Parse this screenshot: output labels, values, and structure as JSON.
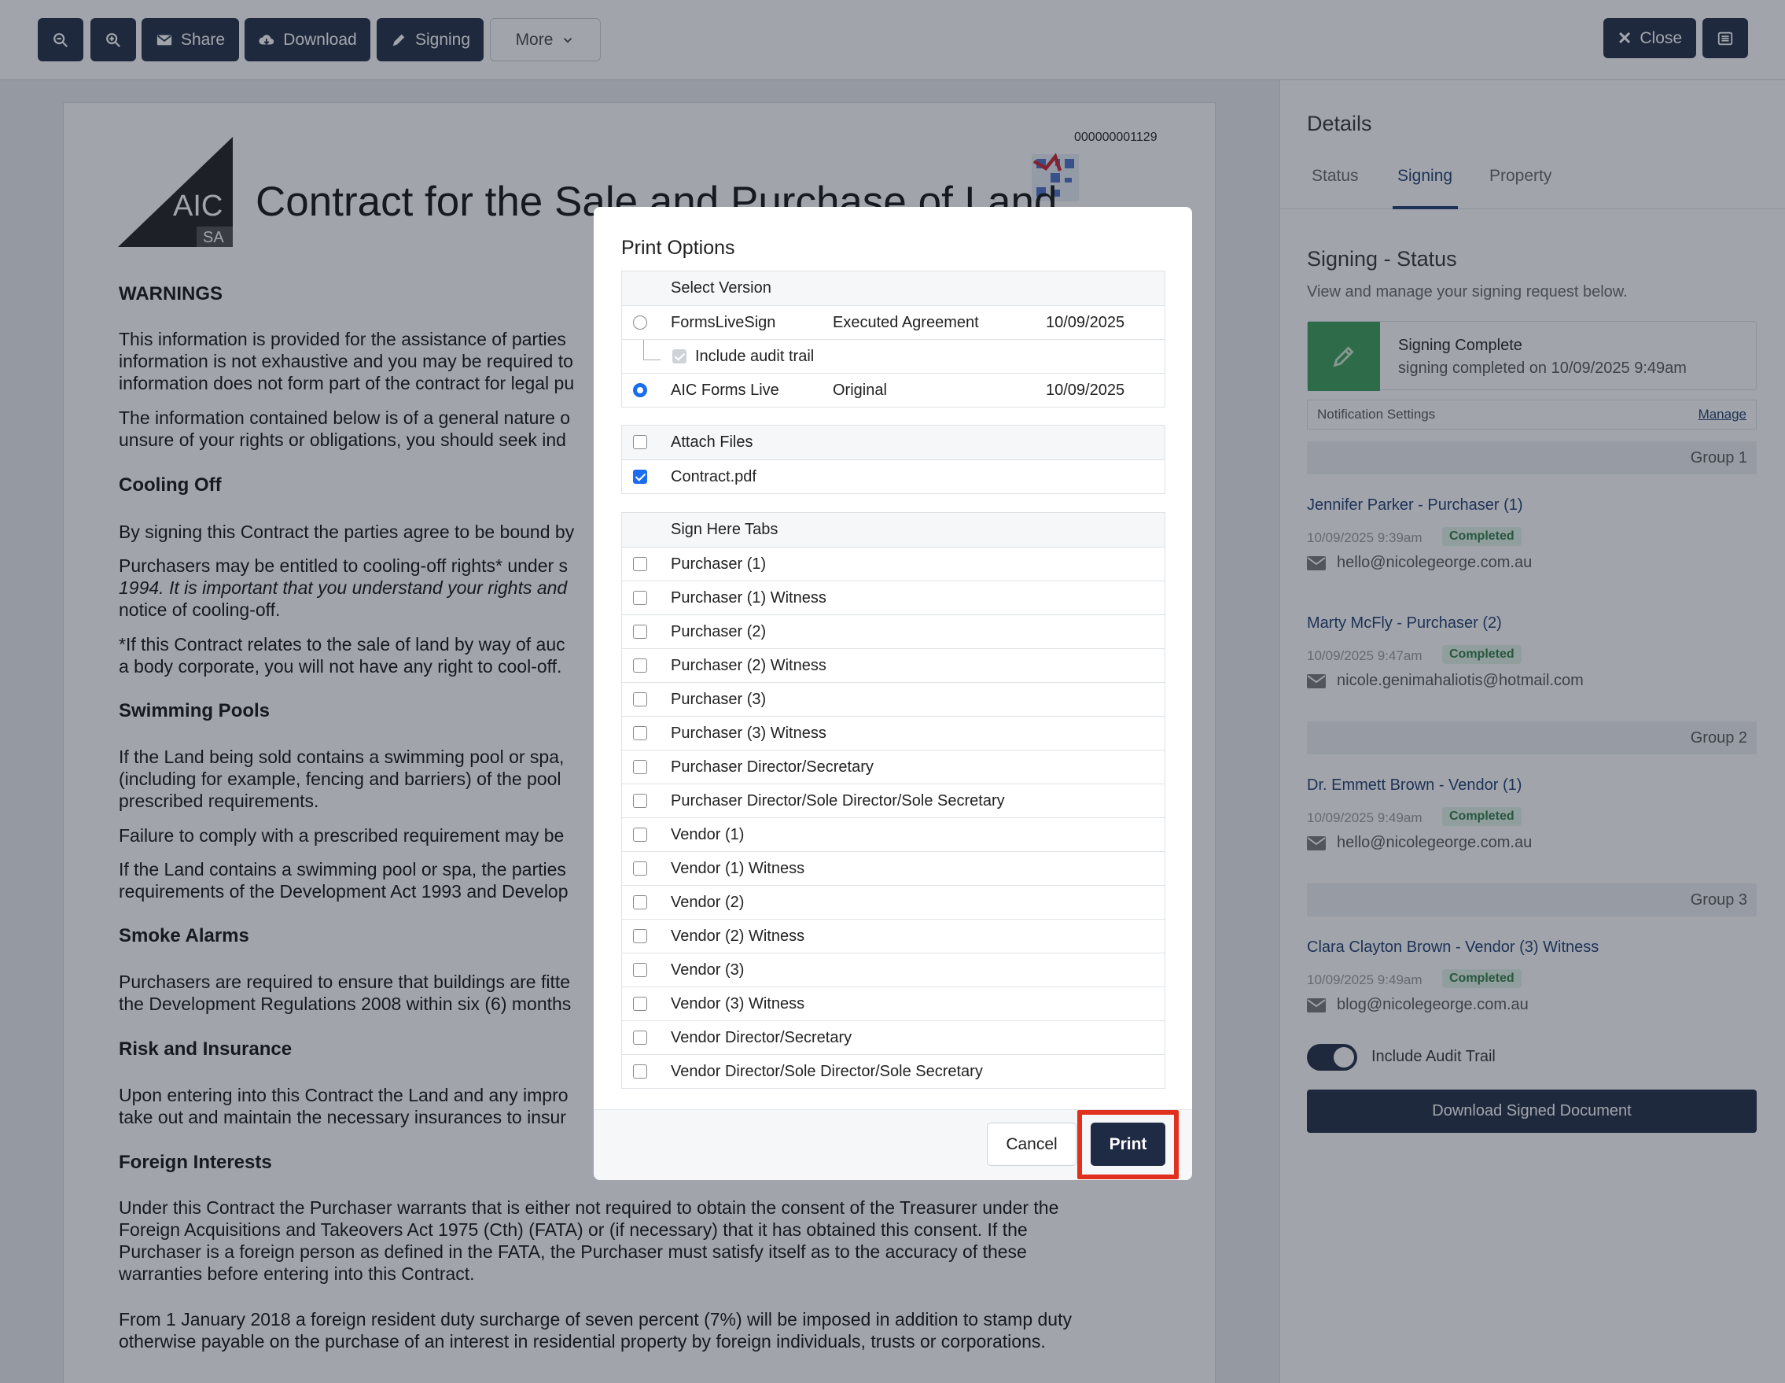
{
  "toolbar": {
    "share": "Share",
    "download": "Download",
    "signing": "Signing",
    "more": "More",
    "close": "Close"
  },
  "document": {
    "number": "000000001129",
    "logo_text": "AIC",
    "logo_sub": "SA",
    "title": "Contract for the Sale and Purchase of Land",
    "warnings_heading": "WARNINGS",
    "p1": "This information is provided for the assistance of parties",
    "p1b": "information is not exhaustive and you may be required to",
    "p1c": "information does not form part of the contract for legal pu",
    "p2": "The information contained below is of a general nature o",
    "p2b": "unsure of your rights or obligations, you should seek ind",
    "cooling_heading": "Cooling Off",
    "p3": "By signing this Contract the parties agree to be bound by",
    "p4": "Purchasers may be entitled to cooling-off rights* under s",
    "p4b": "1994. It is important that you understand your rights and",
    "p4c": "notice of cooling-off.",
    "p5": "*If this Contract relates to the sale of land by way of auc",
    "p5b": "a body corporate, you will not have any right to cool-off.",
    "pools_heading": "Swimming Pools",
    "p6": "If the Land being sold contains a swimming pool or spa,",
    "p6b": "(including for example, fencing and barriers) of the pool",
    "p6c": "prescribed requirements.",
    "p7": "Failure to comply with a prescribed requirement may be",
    "p8": "If the Land contains a swimming pool or spa, the parties",
    "p8b": "requirements of the Development Act 1993 and Develop",
    "smoke_heading": "Smoke Alarms",
    "p9": "Purchasers are required to ensure that buildings are fitte",
    "p9b": "the Development Regulations 2008 within six (6) months",
    "risk_heading": "Risk and Insurance",
    "p10": "Upon entering into this Contract the Land and any impro",
    "p10b": "take out and maintain the necessary insurances to insur",
    "foreign_heading": "Foreign Interests",
    "p11": "Under this Contract the Purchaser warrants that is either not required to obtain the consent of the Treasurer under the",
    "p11b": "Foreign Acquisitions and Takeovers Act 1975 (Cth) (FATA) or (if necessary) that it has obtained this consent. If the",
    "p11c": "Purchaser is a foreign person as defined in the FATA, the Purchaser must satisfy itself as to the accuracy of these",
    "p11d": "warranties before entering into this Contract.",
    "p12": "From 1 January 2018 a foreign resident duty surcharge of seven percent (7%) will be imposed in addition to stamp duty",
    "p12b": "otherwise payable on the purchase of an interest in residential property by foreign individuals, trusts or corporations."
  },
  "panel": {
    "title": "Details",
    "tabs": [
      "Status",
      "Signing",
      "Property"
    ],
    "heading": "Signing - Status",
    "subtext": "View and manage your signing request below.",
    "status_title": "Signing Complete",
    "status_sub": "signing completed on 10/09/2025 9:49am",
    "notif_label": "Notification Settings",
    "notif_manage": "Manage",
    "groups": [
      "Group 1",
      "Group 2",
      "Group 3"
    ],
    "signers": [
      {
        "name": "Jennifer Parker - Purchaser (1)",
        "time": "10/09/2025 9:39am",
        "status": "Completed",
        "email": "hello@nicolegeorge.com.au"
      },
      {
        "name": "Marty McFly - Purchaser (2)",
        "time": "10/09/2025 9:47am",
        "status": "Completed",
        "email": "nicole.genimahaliotis@hotmail.com"
      },
      {
        "name": "Dr. Emmett Brown - Vendor (1)",
        "time": "10/09/2025 9:49am",
        "status": "Completed",
        "email": "hello@nicolegeorge.com.au"
      },
      {
        "name": "Clara Clayton Brown - Vendor (3) Witness",
        "time": "10/09/2025 9:49am",
        "status": "Completed",
        "email": "blog@nicolegeorge.com.au"
      }
    ],
    "include_audit": "Include Audit Trail",
    "download_btn": "Download Signed Document"
  },
  "modal": {
    "title": "Print Options",
    "version_header": "Select Version",
    "versions": [
      {
        "source": "FormsLiveSign",
        "type": "Executed Agreement",
        "date": "10/09/2025"
      },
      {
        "source": "AIC Forms Live",
        "type": "Original",
        "date": "10/09/2025"
      }
    ],
    "audit_trail": "Include audit trail",
    "attach_header": "Attach Files",
    "file": "Contract.pdf",
    "tabs_header": "Sign Here Tabs",
    "tabs": [
      "Purchaser (1)",
      "Purchaser (1) Witness",
      "Purchaser (2)",
      "Purchaser (2) Witness",
      "Purchaser (3)",
      "Purchaser (3) Witness",
      "Purchaser Director/Secretary",
      "Purchaser Director/Sole Director/Sole Secretary",
      "Vendor (1)",
      "Vendor (1) Witness",
      "Vendor (2)",
      "Vendor (2) Witness",
      "Vendor (3)",
      "Vendor (3) Witness",
      "Vendor Director/Secretary",
      "Vendor Director/Sole Director/Sole Secretary"
    ],
    "cancel": "Cancel",
    "print": "Print"
  }
}
